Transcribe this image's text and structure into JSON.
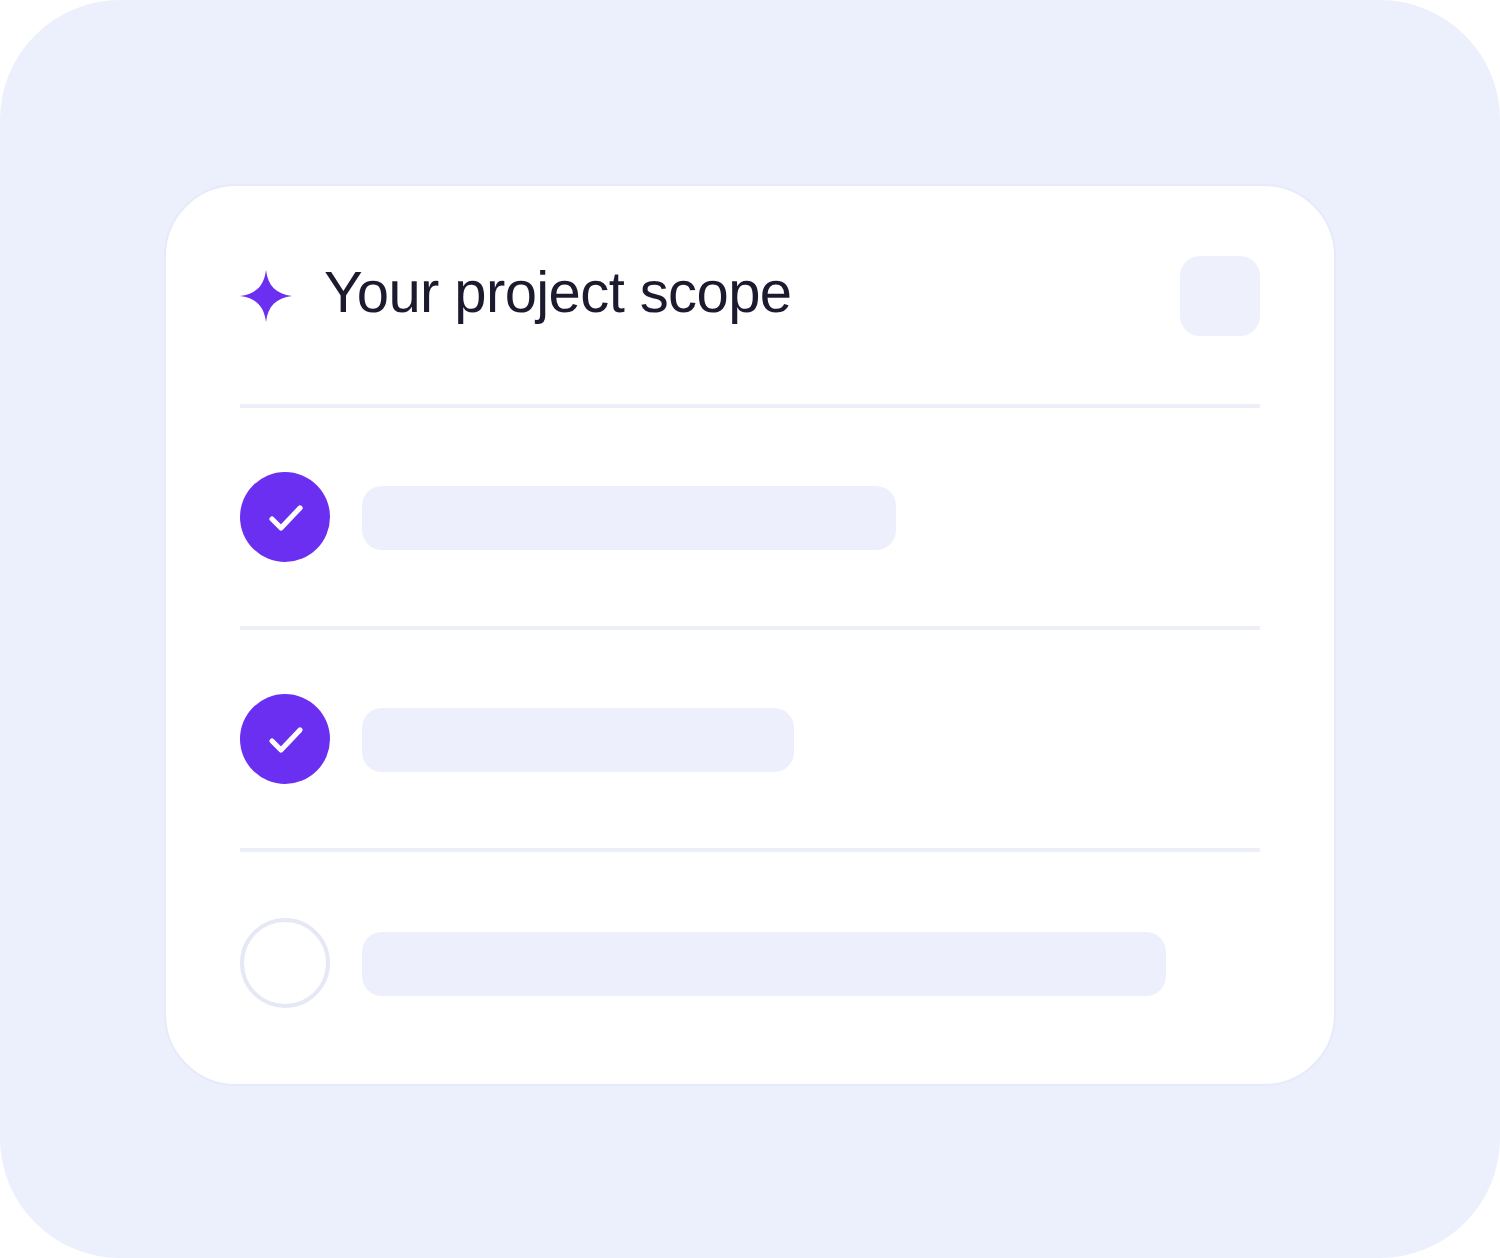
{
  "card": {
    "title": "Your project scope"
  },
  "items": [
    {
      "checked": true
    },
    {
      "checked": true
    },
    {
      "checked": false
    }
  ]
}
